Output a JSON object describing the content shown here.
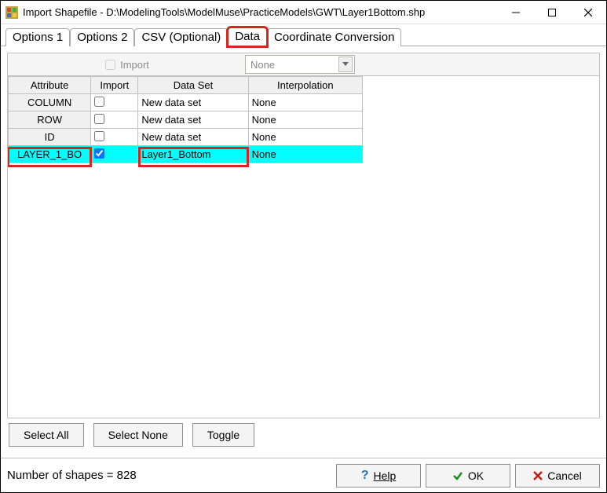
{
  "window": {
    "title": "Import Shapefile - D:\\ModelingTools\\ModelMuse\\PracticeModels\\GWT\\Layer1Bottom.shp"
  },
  "tabs": {
    "items": [
      {
        "label": "Options 1"
      },
      {
        "label": "Options 2"
      },
      {
        "label": "CSV (Optional)"
      },
      {
        "label": "Data"
      },
      {
        "label": "Coordinate Conversion"
      }
    ],
    "active_index": 3
  },
  "import_row": {
    "checkbox_label": "Import",
    "combo_value": "None"
  },
  "grid": {
    "headers": {
      "attr": "Attribute",
      "import": "Import",
      "dataset": "Data Set",
      "interp": "Interpolation"
    },
    "rows": [
      {
        "attr": "COLUMN",
        "import": false,
        "dataset": "New data set",
        "interp": "None",
        "highlight": false
      },
      {
        "attr": "ROW",
        "import": false,
        "dataset": "New data set",
        "interp": "None",
        "highlight": false
      },
      {
        "attr": "ID",
        "import": false,
        "dataset": "New data set",
        "interp": "None",
        "highlight": false
      },
      {
        "attr": "LAYER_1_BO",
        "import": true,
        "dataset": "Layer1_Bottom",
        "interp": "None",
        "highlight": true
      }
    ]
  },
  "buttons": {
    "select_all": "Select All",
    "select_none": "Select None",
    "toggle": "Toggle"
  },
  "footer": {
    "status": "Number of shapes = 828",
    "help": "Help",
    "ok": "OK",
    "cancel": "Cancel"
  }
}
